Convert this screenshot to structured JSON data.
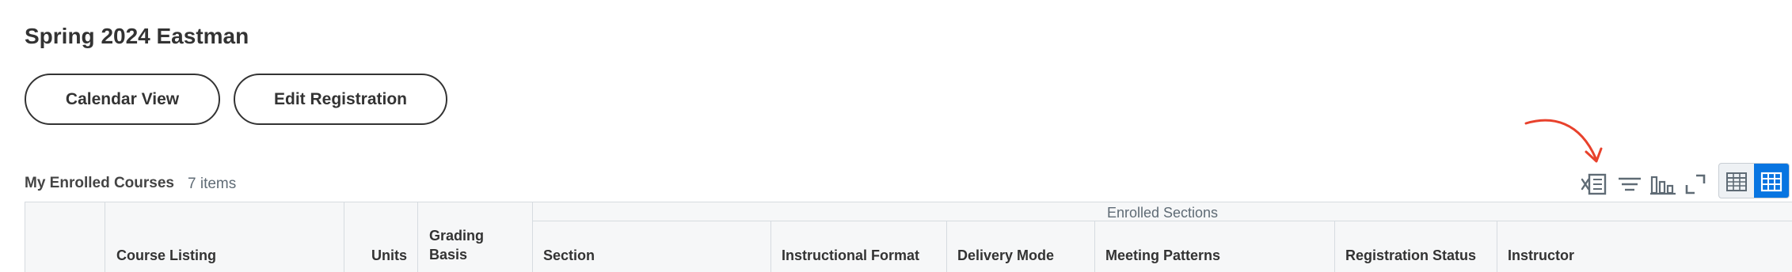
{
  "page": {
    "title": "Spring 2024 Eastman"
  },
  "actions": {
    "calendar_view_label": "Calendar View",
    "edit_registration_label": "Edit Registration"
  },
  "enrolled": {
    "title": "My Enrolled Courses",
    "count": "7 items"
  },
  "toolbar": {
    "icons": [
      "export-to-excel-icon",
      "filter-icon",
      "chart-icon",
      "fullscreen-icon",
      "table-view-icon",
      "grid-view-icon"
    ],
    "active_view": "grid-view",
    "accent_color": "#0875e1",
    "annotation_color": "#e8412c"
  },
  "table": {
    "group_header": "Enrolled Sections",
    "columns": {
      "course_listing": "Course Listing",
      "units": "Units",
      "grading_basis_line1": "Grading",
      "grading_basis_line2": "Basis",
      "section": "Section",
      "instructional_format": "Instructional Format",
      "delivery_mode": "Delivery Mode",
      "meeting_patterns": "Meeting Patterns",
      "registration_status": "Registration Status",
      "instructor": "Instructor"
    }
  }
}
